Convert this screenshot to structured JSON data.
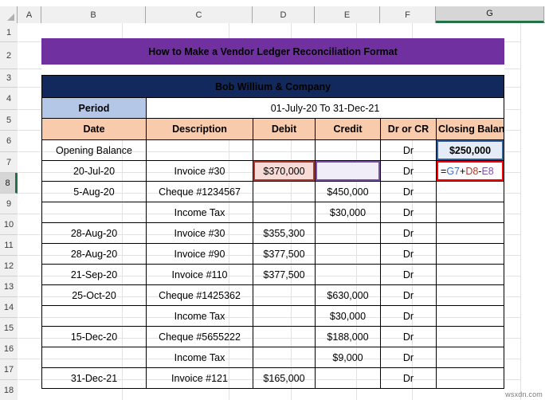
{
  "app": {
    "name": "spreadsheet",
    "watermark": "wsxdn.com"
  },
  "column_headers": [
    {
      "label": "A",
      "width": 30,
      "active": false
    },
    {
      "label": "B",
      "width": 131,
      "active": false
    },
    {
      "label": "C",
      "width": 134,
      "active": false
    },
    {
      "label": "D",
      "width": 78,
      "active": false
    },
    {
      "label": "E",
      "width": 82,
      "active": false
    },
    {
      "label": "F",
      "width": 70,
      "active": false
    },
    {
      "label": "G",
      "width": 136,
      "active": true
    }
  ],
  "row_headers": [
    {
      "label": "1",
      "height": 24,
      "active": false
    },
    {
      "label": "2",
      "height": 34,
      "active": false
    },
    {
      "label": "3",
      "height": 23,
      "active": false
    },
    {
      "label": "4",
      "height": 28,
      "active": false
    },
    {
      "label": "5",
      "height": 26,
      "active": false
    },
    {
      "label": "6",
      "height": 27,
      "active": false
    },
    {
      "label": "7",
      "height": 26,
      "active": false
    },
    {
      "label": "8",
      "height": 26,
      "active": true
    },
    {
      "label": "9",
      "height": 26,
      "active": false
    },
    {
      "label": "10",
      "height": 26,
      "active": false
    },
    {
      "label": "11",
      "height": 26,
      "active": false
    },
    {
      "label": "12",
      "height": 26,
      "active": false
    },
    {
      "label": "13",
      "height": 26,
      "active": false
    },
    {
      "label": "14",
      "height": 26,
      "active": false
    },
    {
      "label": "15",
      "height": 26,
      "active": false
    },
    {
      "label": "16",
      "height": 26,
      "active": false
    },
    {
      "label": "17",
      "height": 26,
      "active": false
    },
    {
      "label": "18",
      "height": 26,
      "active": false
    }
  ],
  "report": {
    "title": "How to Make a Vendor Ledger Reconciliation Format",
    "company": "Bob Willium & Company",
    "period_label": "Period",
    "period_value": "01-July-20 To 31-Dec-21",
    "columns": [
      "Date",
      "Description",
      "Debit",
      "Credit",
      "Dr or CR",
      "Closing Balance"
    ],
    "rows": [
      {
        "date": "Opening Balance",
        "description": "",
        "debit": "",
        "credit": "",
        "drcr": "Dr",
        "closing": "$250,000"
      },
      {
        "date": "20-Jul-20",
        "description": "Invoice #30",
        "debit": "$370,000",
        "credit": "",
        "drcr": "Dr",
        "closing": ""
      },
      {
        "date": "5-Aug-20",
        "description": "Cheque #1234567",
        "debit": "",
        "credit": "$450,000",
        "drcr": "Dr",
        "closing": ""
      },
      {
        "date": "",
        "description": "Income Tax",
        "debit": "",
        "credit": "$30,000",
        "drcr": "Dr",
        "closing": ""
      },
      {
        "date": "28-Aug-20",
        "description": "Invoice #30",
        "debit": "$355,300",
        "credit": "",
        "drcr": "Dr",
        "closing": ""
      },
      {
        "date": "28-Aug-20",
        "description": "Invoice #90",
        "debit": "$377,500",
        "credit": "",
        "drcr": "Dr",
        "closing": ""
      },
      {
        "date": "21-Sep-20",
        "description": "Invoice #110",
        "debit": "$377,500",
        "credit": "",
        "drcr": "Dr",
        "closing": ""
      },
      {
        "date": "25-Oct-20",
        "description": "Cheque #1425362",
        "debit": "",
        "credit": "$630,000",
        "drcr": "Dr",
        "closing": ""
      },
      {
        "date": "",
        "description": "Income Tax",
        "debit": "",
        "credit": "$30,000",
        "drcr": "Dr",
        "closing": ""
      },
      {
        "date": "15-Dec-20",
        "description": "Cheque #5655222",
        "debit": "",
        "credit": "$188,000",
        "drcr": "Dr",
        "closing": ""
      },
      {
        "date": "",
        "description": "Income Tax",
        "debit": "",
        "credit": "$9,000",
        "drcr": "Dr",
        "closing": ""
      },
      {
        "date": "31-Dec-21",
        "description": "Invoice #121",
        "debit": "$165,000",
        "credit": "",
        "drcr": "Dr",
        "closing": ""
      }
    ]
  },
  "formula": {
    "editing_cell": "G8",
    "equals": "=",
    "ref1": "G7",
    "op1": "+",
    "ref2": "D8",
    "op2": "-",
    "ref3": "E8"
  },
  "colors": {
    "title_purple": "#7030A0",
    "company_navy": "#12295E",
    "period_blue": "#B4C7E7",
    "header_peach": "#F8CBAD",
    "ref_blue": "#2E5FA3",
    "ref_red": "#A83B32",
    "ref_purple": "#7B4FA8",
    "editing_red": "#FF0000",
    "excel_green": "#217346"
  }
}
